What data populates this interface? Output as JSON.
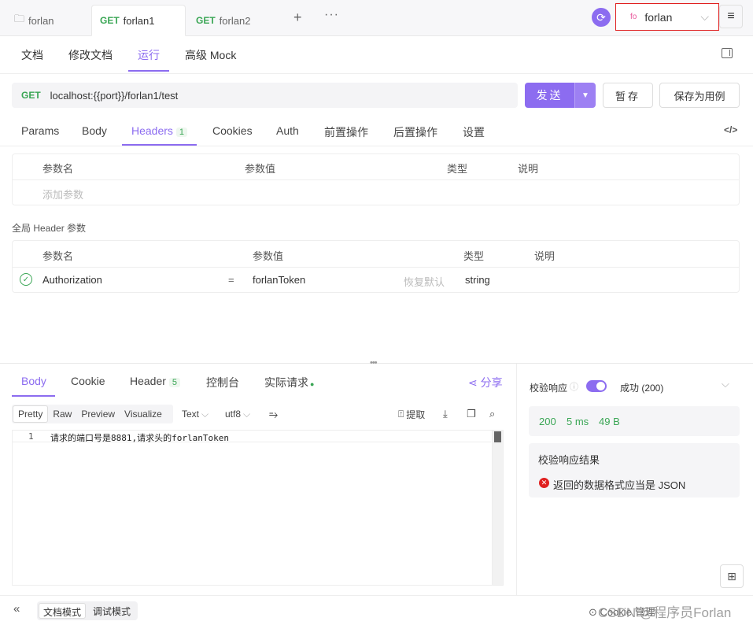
{
  "tabs": [
    {
      "method": "",
      "label": "forlan"
    },
    {
      "method": "GET",
      "label": "forlan1"
    },
    {
      "method": "GET",
      "label": "forlan2"
    }
  ],
  "env": {
    "short": "fo",
    "name": "forlan"
  },
  "subnav": [
    "文档",
    "修改文档",
    "运行",
    "高级 Mock"
  ],
  "url": {
    "method": "GET",
    "value": "localhost:{{port}}/forlan1/test"
  },
  "buttons": {
    "send": "发送",
    "save": "暂存",
    "save_case": "保存为用例"
  },
  "req_tabs": [
    "Params",
    "Body",
    "Headers",
    "Cookies",
    "Auth",
    "前置操作",
    "后置操作",
    "设置"
  ],
  "headers_count": "1",
  "param_table": {
    "columns": [
      "参数名",
      "参数值",
      "类型",
      "说明"
    ],
    "add_placeholder": "添加参数"
  },
  "global_header": {
    "title": "全局 Header 参数",
    "columns": [
      "参数名",
      "参数值",
      "类型",
      "说明"
    ],
    "rows": [
      {
        "name": "Authorization",
        "eq": "=",
        "value": "forlanToken",
        "restore": "恢复默认",
        "type": "string"
      }
    ]
  },
  "resp_tabs": [
    "Body",
    "Cookie",
    "Header",
    "控制台",
    "实际请求"
  ],
  "resp_header_count": "5",
  "share": "分享",
  "formats": [
    "Pretty",
    "Raw",
    "Preview",
    "Visualize"
  ],
  "text_sel": "Text",
  "enc_sel": "utf8",
  "extract": "提取",
  "code_lines": [
    {
      "num": "1",
      "text": "请求的端口号是8881,请求头的forlanToken"
    }
  ],
  "validate": {
    "label": "校验响应",
    "status": "成功 (200)",
    "code": "200",
    "time": "5 ms",
    "size": "49 B",
    "result_title": "校验响应结果",
    "error": "返回的数据格式应当是 JSON"
  },
  "modes": [
    "文档模式",
    "调试模式"
  ],
  "watermark": "CSDN @程序员Forlan",
  "bottom_right": "Cookie 管理"
}
